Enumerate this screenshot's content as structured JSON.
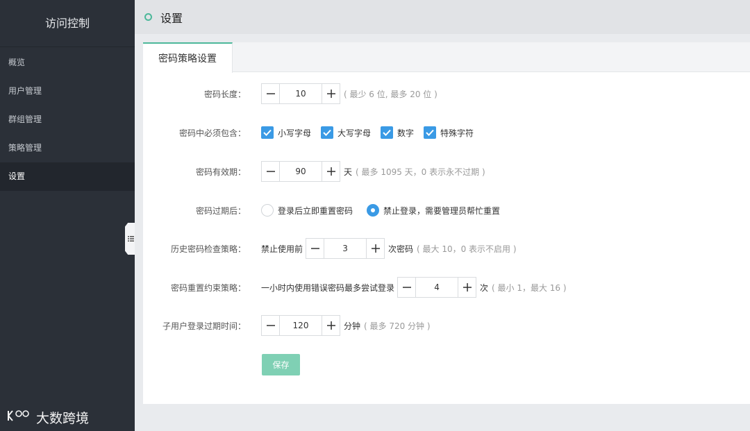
{
  "sidebar": {
    "title": "访问控制",
    "items": [
      {
        "label": "概览"
      },
      {
        "label": "用户管理"
      },
      {
        "label": "群组管理"
      },
      {
        "label": "策略管理"
      },
      {
        "label": "设置",
        "active": true
      }
    ]
  },
  "watermark": {
    "text": "大数跨境"
  },
  "header": {
    "title": "设置"
  },
  "tabs": [
    {
      "label": "密码策略设置",
      "active": true
    }
  ],
  "form": {
    "length": {
      "label": "密码长度：",
      "value": "10",
      "hint": "( 最少 6 位, 最多 20 位 )"
    },
    "contains": {
      "label": "密码中必须包含：",
      "options": [
        {
          "label": "小写字母",
          "checked": true
        },
        {
          "label": "大写字母",
          "checked": true
        },
        {
          "label": "数字",
          "checked": true
        },
        {
          "label": "特殊字符",
          "checked": true
        }
      ]
    },
    "validity": {
      "label": "密码有效期：",
      "value": "90",
      "unit": "天",
      "hint": "( 最多 1095 天，0 表示永不过期 )"
    },
    "expiry": {
      "label": "密码过期后：",
      "options": [
        {
          "label": "登录后立即重置密码",
          "selected": false
        },
        {
          "label": "禁止登录，需要管理员帮忙重置",
          "selected": true
        }
      ]
    },
    "history": {
      "label": "历史密码检查策略：",
      "prefix": "禁止使用前",
      "value": "3",
      "unit": "次密码",
      "hint": "( 最大 10，0 表示不启用 )"
    },
    "retry": {
      "label": "密码重置约束策略：",
      "prefix": "一小时内使用错误密码最多尝试登录",
      "value": "4",
      "unit": "次",
      "hint": "( 最小 1，最大 16 )"
    },
    "session": {
      "label": "子用户登录过期时间：",
      "value": "120",
      "unit": "分钟",
      "hint": "( 最多 720 分钟 )"
    },
    "save_label": "保存"
  },
  "colors": {
    "accent": "#4cb89a",
    "checkbox": "#3a9ae5",
    "sidebar_bg": "#2b3038",
    "save_button": "#7fd0b4"
  }
}
